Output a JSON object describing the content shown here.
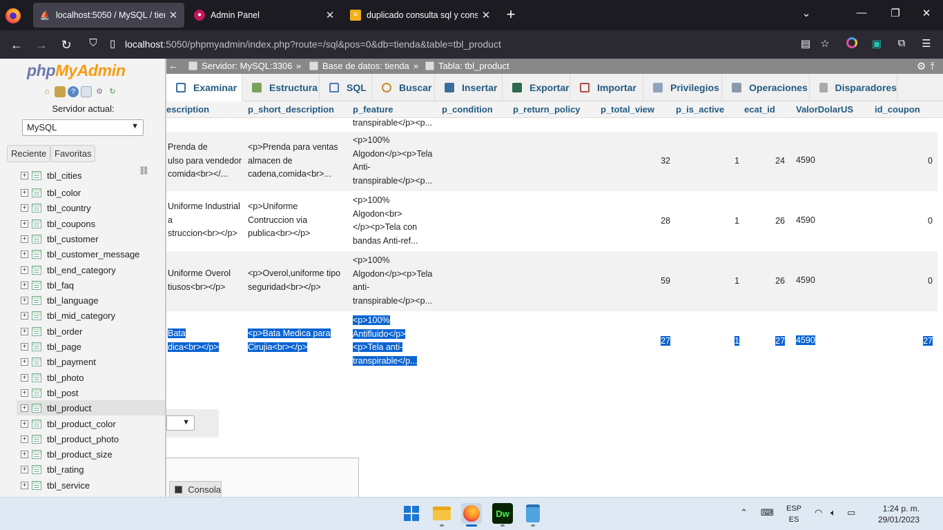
{
  "browser": {
    "tabs": [
      {
        "title": "localhost:5050 / MySQL / tienda",
        "active": true
      },
      {
        "title": "Admin Panel",
        "active": false
      },
      {
        "title": "duplicado consulta sql y consult",
        "active": false
      }
    ],
    "url_host": "localhost",
    "url_rest": ":5050/phpmyadmin/index.php?route=/sql&pos=0&db=tienda&table=tbl_product"
  },
  "sidebar": {
    "logo_php": "php",
    "logo_myadmin": "MyAdmin",
    "server_label": "Servidor actual:",
    "server_value": "MySQL",
    "recent_label": "Reciente",
    "favorites_label": "Favoritas",
    "tables": [
      "tbl_cities",
      "tbl_color",
      "tbl_country",
      "tbl_coupons",
      "tbl_customer",
      "tbl_customer_message",
      "tbl_end_category",
      "tbl_faq",
      "tbl_language",
      "tbl_mid_category",
      "tbl_order",
      "tbl_page",
      "tbl_payment",
      "tbl_photo",
      "tbl_post",
      "tbl_product",
      "tbl_product_color",
      "tbl_product_photo",
      "tbl_product_size",
      "tbl_rating",
      "tbl_service"
    ],
    "selected_table": "tbl_product"
  },
  "breadcrumb": {
    "server": "Servidor: MySQL:3306",
    "database": "Base de datos: tienda",
    "table": "Tabla: tbl_product"
  },
  "tabs": [
    {
      "label": "Examinar",
      "color": "#3a6ea5"
    },
    {
      "label": "Estructura",
      "color": "#5a8a3a"
    },
    {
      "label": "SQL",
      "color": "#4a7ab0"
    },
    {
      "label": "Buscar",
      "color": "#c28a2a"
    },
    {
      "label": "Insertar",
      "color": "#3f6d9a"
    },
    {
      "label": "Exportar",
      "color": "#2d6a4f"
    },
    {
      "label": "Importar",
      "color": "#b04a4a"
    },
    {
      "label": "Privilegios",
      "color": "#5a6e8a"
    },
    {
      "label": "Operaciones",
      "color": "#6a7d8e"
    },
    {
      "label": "Disparadores",
      "color": "#7a7a7a"
    }
  ],
  "columns": [
    "escription",
    "p_short_description",
    "p_feature",
    "p_condition",
    "p_return_policy",
    "p_total_view",
    "p_is_active",
    "ecat_id",
    "ValorDolarUS",
    "id_coupon"
  ],
  "partial_row_text": "transpirable</p><p...",
  "rows": [
    {
      "desc": [
        "Prenda de",
        "ulso para vendedor",
        "comida<br></..."
      ],
      "short": [
        "<p>Prenda para ventas",
        "almacen de",
        "cadena,comida<br>..."
      ],
      "feature": [
        "<p>100%",
        "Algodon</p><p>Tela",
        "Anti-",
        "transpirable</p><p..."
      ],
      "total_view": "32",
      "is_active": "1",
      "ecat_id": "24",
      "valor": "4590",
      "id_coupon": "0"
    },
    {
      "desc": [
        "Uniforme Industrial",
        "a",
        "struccion<br></p>"
      ],
      "short": [
        "<p>Uniforme",
        "Contruccion via",
        "publica<br></p>"
      ],
      "feature": [
        "<p>100%",
        "Algodon<br>",
        "</p><p>Tela con",
        "bandas Anti-ref..."
      ],
      "total_view": "28",
      "is_active": "1",
      "ecat_id": "26",
      "valor": "4590",
      "id_coupon": "0"
    },
    {
      "desc": [
        "Uniforme Overol",
        "tiusos<br></p>"
      ],
      "short": [
        "<p>Overol,uniforme tipo",
        "seguridad<br></p>"
      ],
      "feature": [
        "<p>100%",
        "Algodon</p><p>Tela",
        "anti-",
        "transpirable</p><p..."
      ],
      "total_view": "59",
      "is_active": "1",
      "ecat_id": "26",
      "valor": "4590",
      "id_coupon": "0"
    },
    {
      "desc": [
        "Bata",
        "dica<br></p>"
      ],
      "short": [
        "<p>Bata Medica para",
        "Cirujia<br></p>"
      ],
      "feature": [
        "<p>100%",
        "Antifluido</p>",
        "<p>Tela anti-",
        "transpirable</p..."
      ],
      "total_view": "27",
      "is_active": "1",
      "ecat_id": "27",
      "valor": "4590",
      "id_coupon": "27"
    }
  ],
  "console_label": "Consola",
  "taskbar": {
    "lang_top": "ESP",
    "lang_bottom": "ES",
    "time": "1:24 p. m.",
    "date": "29/01/2023"
  }
}
